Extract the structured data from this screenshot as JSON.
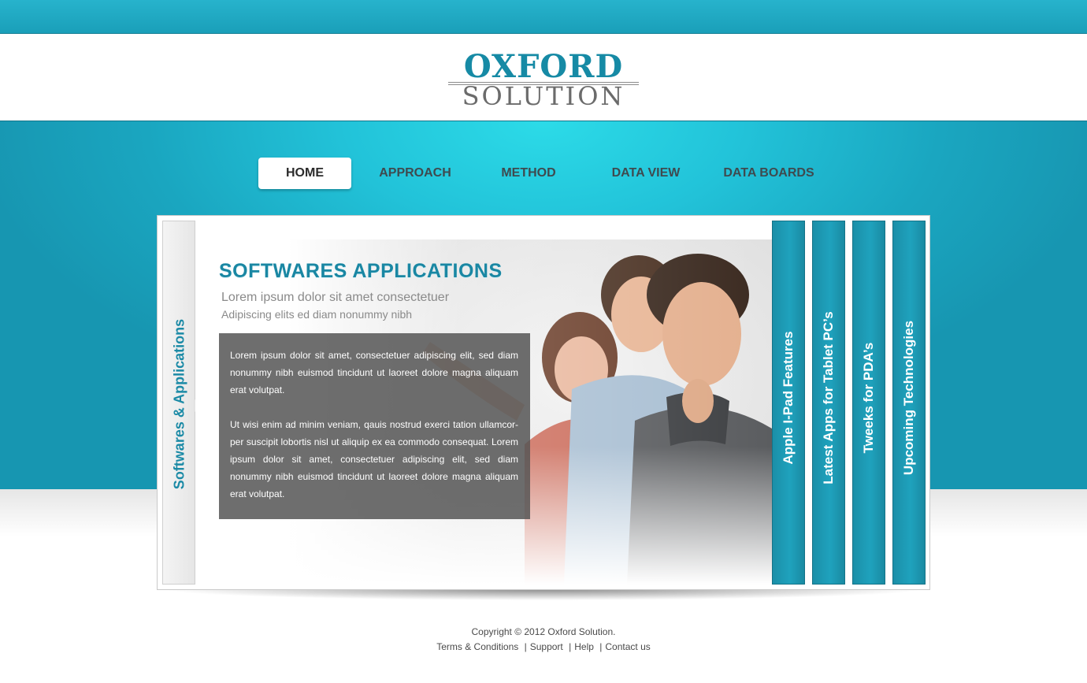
{
  "brand": {
    "logo_top": "OXFORD",
    "logo_bottom": "SOLUTION",
    "colors": {
      "primary": "#1ba3bd",
      "accent_light": "#2cdbe8",
      "text_dark": "#3f4a4f"
    }
  },
  "nav": {
    "items": [
      {
        "label": "HOME",
        "active": true
      },
      {
        "label": "APPROACH",
        "active": false
      },
      {
        "label": "METHOD",
        "active": false
      },
      {
        "label": "DATA VIEW",
        "active": false
      },
      {
        "label": "DATA BOARDS",
        "active": false
      }
    ]
  },
  "panel": {
    "side_tab_label": "Softwares & Applications",
    "title": "SOFTWARES APPLICATIONS",
    "subtitle1": "Lorem ipsum dolor sit amet consectetuer",
    "subtitle2": "Adipiscing elits ed diam nonummy nibh",
    "paragraphs": [
      "Lorem ipsum dolor sit amet, consectetuer adipiscing elit, sed diam nonummy nibh euismod tincidunt ut laoreet dolore magna aliquam erat volutpat.",
      "Ut wisi enim ad minim veniam, qauis nostrud exerci tation ullamcor-per suscipit lobortis nisl ut aliquip ex ea commodo consequat. Lorem ipsum dolor sit amet, consectetuer adipiscing elit, sed diam nonummy nibh euismod tincidunt ut laoreet dolore magna aliquam erat volutpat."
    ],
    "photo_icon": "team-photo",
    "vertical_tabs": [
      "Apple I-Pad Features",
      "Latest Apps for Tablet PC’s",
      "Tweeks for PDA’s",
      "Upcoming Technologies"
    ]
  },
  "footer": {
    "copyright": "Copyright © 2012 Oxford Solution.",
    "links": [
      "Terms & Conditions",
      "Support",
      "Help",
      "Contact us"
    ]
  }
}
